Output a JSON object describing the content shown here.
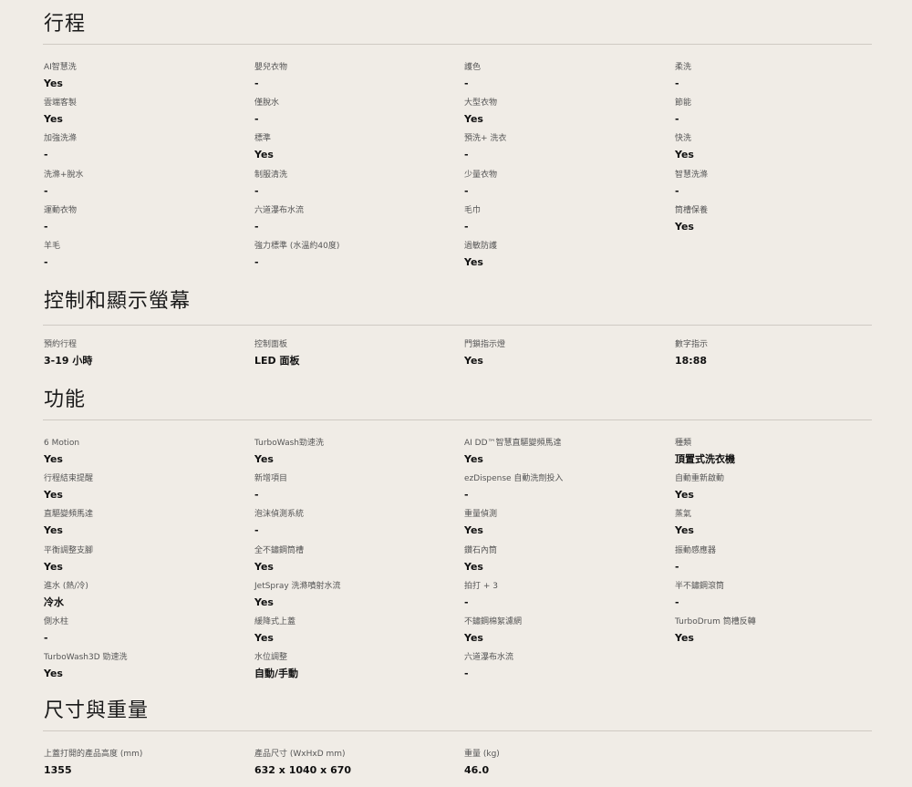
{
  "sections": [
    {
      "title": "行程",
      "items": [
        {
          "label": "AI智慧洗",
          "value": "Yes"
        },
        {
          "label": "嬰兒衣物",
          "value": "-"
        },
        {
          "label": "護色",
          "value": "-"
        },
        {
          "label": "柔洗",
          "value": "-"
        },
        {
          "label": "雲端客製",
          "value": "Yes"
        },
        {
          "label": "僅脫水",
          "value": "-"
        },
        {
          "label": "大型衣物",
          "value": "Yes"
        },
        {
          "label": "節能",
          "value": "-"
        },
        {
          "label": "加強洗滌",
          "value": "-"
        },
        {
          "label": "標準",
          "value": "Yes"
        },
        {
          "label": "預洗+ 洗衣",
          "value": "-"
        },
        {
          "label": "快洗",
          "value": "Yes"
        },
        {
          "label": "洗滌+脫水",
          "value": "-"
        },
        {
          "label": "制服清洗",
          "value": "-"
        },
        {
          "label": "少量衣物",
          "value": "-"
        },
        {
          "label": "智慧洗滌",
          "value": "-"
        },
        {
          "label": "運動衣物",
          "value": "-"
        },
        {
          "label": "六道瀑布水流",
          "value": "-"
        },
        {
          "label": "毛巾",
          "value": "-"
        },
        {
          "label": "筒槽保養",
          "value": "Yes"
        },
        {
          "label": "羊毛",
          "value": "-"
        },
        {
          "label": "強力標準 (水溫約40度)",
          "value": "-"
        },
        {
          "label": "過敏防護",
          "value": "Yes"
        }
      ]
    },
    {
      "title": "控制和顯示螢幕",
      "items": [
        {
          "label": "預約行程",
          "value": "3-19 小時"
        },
        {
          "label": "控制面板",
          "value": "LED 面板"
        },
        {
          "label": "門鎖指示燈",
          "value": "Yes"
        },
        {
          "label": "數字指示",
          "value": "18:88"
        }
      ]
    },
    {
      "title": "功能",
      "items": [
        {
          "label": "6 Motion",
          "value": "Yes"
        },
        {
          "label": "TurboWash勁速洗",
          "value": "Yes"
        },
        {
          "label": "AI DD™智慧直驅變頻馬達",
          "value": "Yes"
        },
        {
          "label": "種類",
          "value": "頂置式洗衣機"
        },
        {
          "label": "行程結束提醒",
          "value": "Yes"
        },
        {
          "label": "新增項目",
          "value": "-"
        },
        {
          "label": "ezDispense 自動洗劑投入",
          "value": "-"
        },
        {
          "label": "自動重新啟動",
          "value": "Yes"
        },
        {
          "label": "直驅變頻馬達",
          "value": "Yes"
        },
        {
          "label": "泡沫偵測系統",
          "value": "-"
        },
        {
          "label": "重量偵測",
          "value": "Yes"
        },
        {
          "label": "蒸氣",
          "value": "Yes"
        },
        {
          "label": "平衡調整支腳",
          "value": "Yes"
        },
        {
          "label": "全不鏽鋼筒槽",
          "value": "Yes"
        },
        {
          "label": "鑽石內筒",
          "value": "Yes"
        },
        {
          "label": "振動感應器",
          "value": "-"
        },
        {
          "label": "進水 (熱/冷)",
          "value": "冷水"
        },
        {
          "label": "JetSpray 洗滌噴射水流",
          "value": "Yes"
        },
        {
          "label": "拍打 + 3",
          "value": "-"
        },
        {
          "label": "半不鏽鋼滾筒",
          "value": "-"
        },
        {
          "label": "側水柱",
          "value": "-"
        },
        {
          "label": "緩降式上蓋",
          "value": "Yes"
        },
        {
          "label": "不鏽鋼棉絮濾網",
          "value": "Yes"
        },
        {
          "label": "TurboDrum 筒槽反轉",
          "value": "Yes"
        },
        {
          "label": "TurboWash3D 勁速洗",
          "value": "Yes"
        },
        {
          "label": "水位調整",
          "value": "自動/手動"
        },
        {
          "label": "六道瀑布水流",
          "value": "-"
        }
      ]
    },
    {
      "title": "尺寸與重量",
      "items": [
        {
          "label": "上蓋打開的產品高度 (mm)",
          "value": "1355"
        },
        {
          "label": "產品尺寸 (WxHxD mm)",
          "value": "632 x 1040 x 670"
        },
        {
          "label": "重量 (kg)",
          "value": "46.0"
        }
      ]
    }
  ]
}
